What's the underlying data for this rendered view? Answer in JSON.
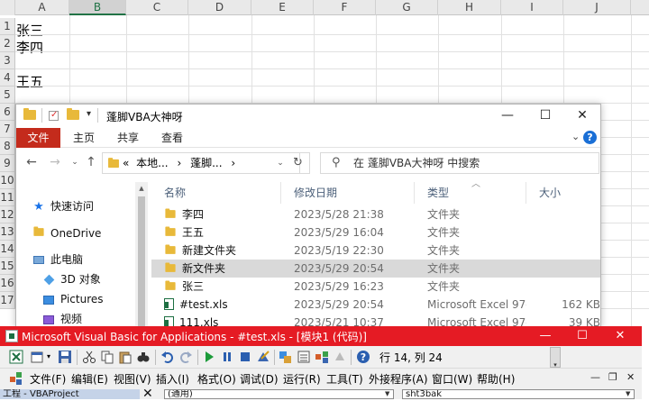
{
  "excel": {
    "columns": [
      "A",
      "B",
      "C",
      "D",
      "E",
      "F",
      "G",
      "H",
      "I",
      "J"
    ],
    "selected_column": "B",
    "rows": [
      "1",
      "2",
      "3",
      "4",
      "5",
      "6",
      "7",
      "8",
      "9",
      "10",
      "11",
      "12",
      "13",
      "14",
      "15",
      "16",
      "17"
    ],
    "cells": {
      "A1": "张三",
      "A2": "李四",
      "A4": "王五"
    }
  },
  "explorer": {
    "title": "蓬脚VBA大神呀",
    "window_controls": {
      "minimize": "—",
      "maximize": "☐",
      "close": "✕"
    },
    "ribbon": {
      "file": "文件",
      "tabs": [
        "主页",
        "共享",
        "查看"
      ],
      "expand": "⌄",
      "help": "?"
    },
    "address": {
      "prefix": "«",
      "crumbs": [
        "本地...",
        "蓬脚...",
        ""
      ],
      "separator": "›",
      "dropdown": "⌄",
      "refresh": "↻"
    },
    "search": {
      "placeholder": "在 蓬脚VBA大神呀 中搜索"
    },
    "nav": {
      "quick_access": "快速访问",
      "onedrive": "OneDrive",
      "this_pc": "此电脑",
      "objects_3d": "3D 对象",
      "pictures": "Pictures",
      "videos": "视频"
    },
    "columns": {
      "name": "名称",
      "date": "修改日期",
      "type": "类型",
      "size": "大小"
    },
    "files": [
      {
        "name": "李四",
        "date": "2023/5/28 21:38",
        "type": "文件夹",
        "size": "",
        "kind": "folder"
      },
      {
        "name": "王五",
        "date": "2023/5/29 16:04",
        "type": "文件夹",
        "size": "",
        "kind": "folder"
      },
      {
        "name": "新建文件夹",
        "date": "2023/5/19 22:30",
        "type": "文件夹",
        "size": "",
        "kind": "folder"
      },
      {
        "name": "新文件夹",
        "date": "2023/5/29 20:54",
        "type": "文件夹",
        "size": "",
        "kind": "folder",
        "selected": true
      },
      {
        "name": "张三",
        "date": "2023/5/29 16:23",
        "type": "文件夹",
        "size": "",
        "kind": "folder"
      },
      {
        "name": "#test.xls",
        "date": "2023/5/29 20:54",
        "type": "Microsoft Excel 97-...",
        "size": "162 KB",
        "kind": "xls"
      },
      {
        "name": "111.xls",
        "date": "2023/5/21 10:37",
        "type": "Microsoft Excel 97-...",
        "size": "39 KB",
        "kind": "xls"
      }
    ]
  },
  "vba": {
    "title": "Microsoft Visual Basic for Applications - #test.xls - [模块1 (代码)]",
    "window_controls": {
      "minimize": "—",
      "maximize": "☐",
      "close": "✕"
    },
    "cursor_position": "行 14, 列 24",
    "menu": [
      "文件(F)",
      "编辑(E)",
      "视图(V)",
      "插入(I)",
      "格式(O)",
      "调试(D)",
      "运行(R)",
      "工具(T)",
      "外接程序(A)",
      "窗口(W)",
      "帮助(H)"
    ],
    "menu_right": {
      "minimize": "—",
      "restore": "❐",
      "close": "✕"
    },
    "project_title": "工程 - VBAProject",
    "object_combo": "(通用)",
    "proc_combo": "sht3bak",
    "accent_color": "#e51b24"
  }
}
